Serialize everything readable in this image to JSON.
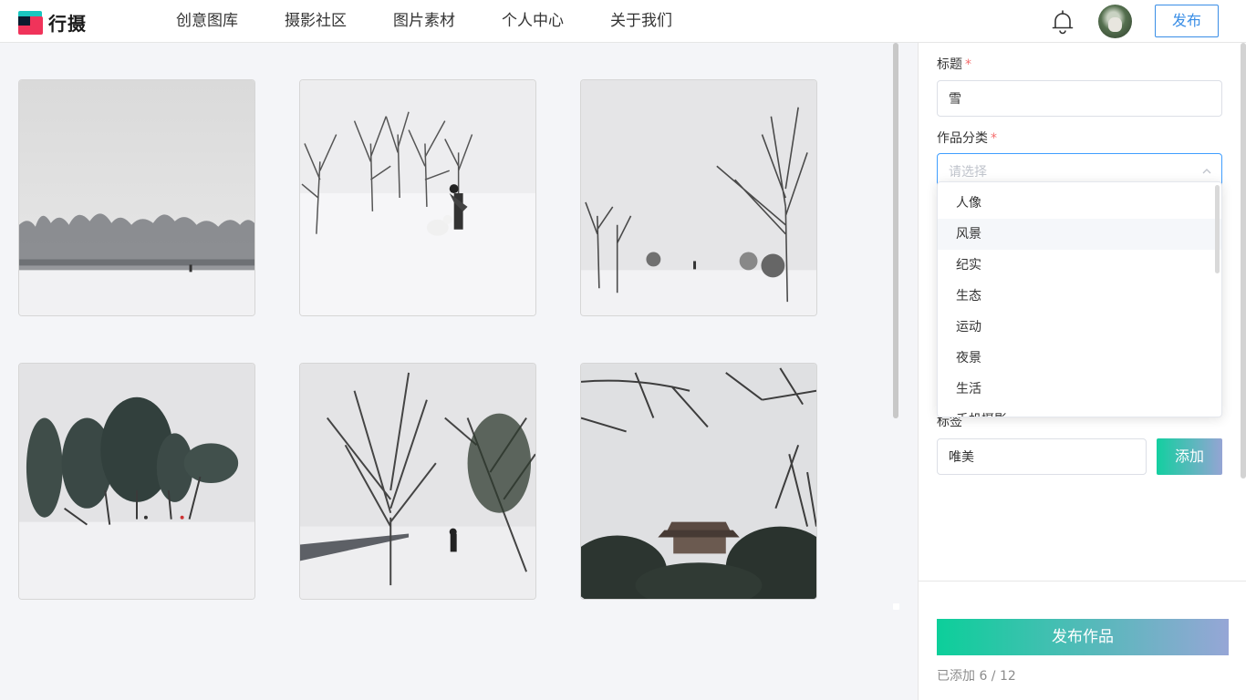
{
  "app": {
    "logo_text": "行摄"
  },
  "nav": {
    "items": [
      "创意图库",
      "摄影社区",
      "图片素材",
      "个人中心",
      "关于我们"
    ]
  },
  "header": {
    "publish_label": "发布"
  },
  "form": {
    "title_label": "标题",
    "title_value": "雪",
    "category_label": "作品分类",
    "category_placeholder": "请选择",
    "category_options": [
      "人像",
      "风景",
      "纪实",
      "生态",
      "运动",
      "夜景",
      "生活",
      "手机摄影"
    ],
    "hovered_option": "风景",
    "tag_label": "标签",
    "tag_value": "唯美",
    "add_label": "添加",
    "required_mark": "*"
  },
  "footer": {
    "submit_label": "发布作品",
    "count_text": "已添加 6 / 12"
  },
  "colors": {
    "accent_blue": "#3a8ee6",
    "gradient_start": "#0ccf9a",
    "gradient_end": "#96a6d6",
    "required": "#f56c6c"
  }
}
